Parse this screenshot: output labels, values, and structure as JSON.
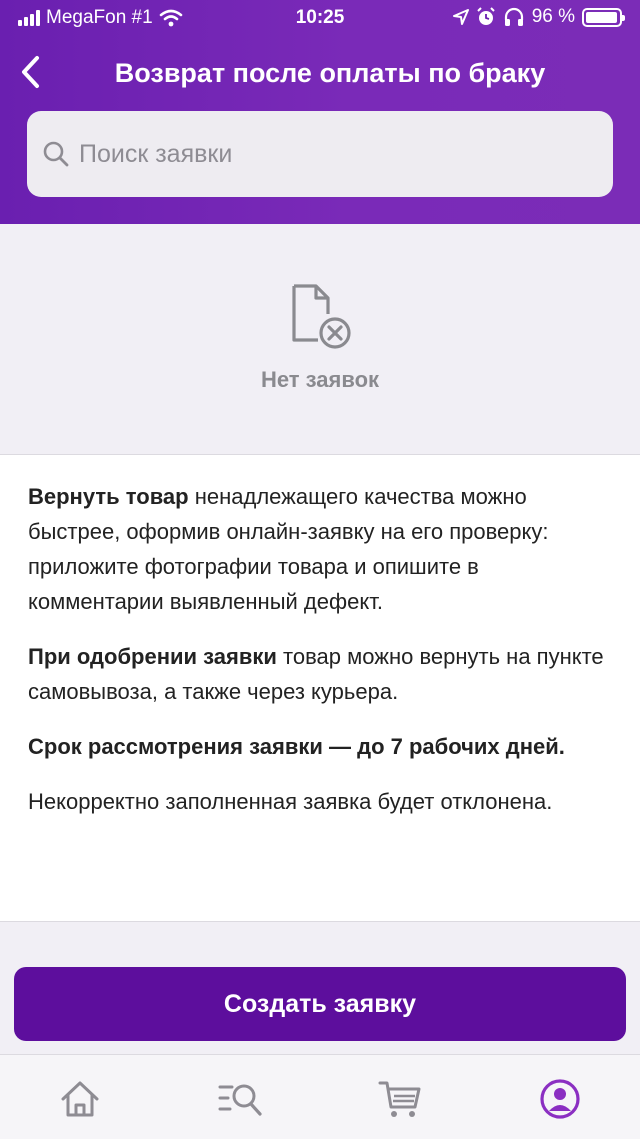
{
  "status_bar": {
    "carrier": "MegaFon #1",
    "time": "10:25",
    "battery": "96 %",
    "battery_level": 0.96
  },
  "header": {
    "title": "Возврат после оплаты по браку",
    "back_icon": "chevron-left-icon"
  },
  "search": {
    "placeholder": "Поиск заявки",
    "icon": "search-icon"
  },
  "empty_state": {
    "icon": "document-cross-icon",
    "text": "Нет заявок"
  },
  "info": {
    "p1_bold": "Вернуть товар",
    "p1_text": " ненадлежащего качества можно быстрее, оформив онлайн-заявку на его проверку: приложите фотографии товара и опишите в комментарии выявленный дефект.",
    "p2_bold": "При одобрении заявки",
    "p2_text": " товар можно вернуть на пункте самовывоза, а также через курьера.",
    "p3_bold": "Срок рассмотрения заявки — до 7 рабочих дней.",
    "p4_text": "Некорректно заполненная заявка будет отклонена."
  },
  "cta": {
    "label": "Создать заявку"
  },
  "tabbar": {
    "items": [
      {
        "icon": "home-icon",
        "active": false
      },
      {
        "icon": "catalog-search-icon",
        "active": false
      },
      {
        "icon": "cart-icon",
        "active": false
      },
      {
        "icon": "profile-icon",
        "active": true
      }
    ]
  },
  "colors": {
    "brand": "#6a1fb0",
    "button": "#5d0e9d",
    "active_tab": "#8b2fc2",
    "inactive_tab": "#8e8c93"
  }
}
